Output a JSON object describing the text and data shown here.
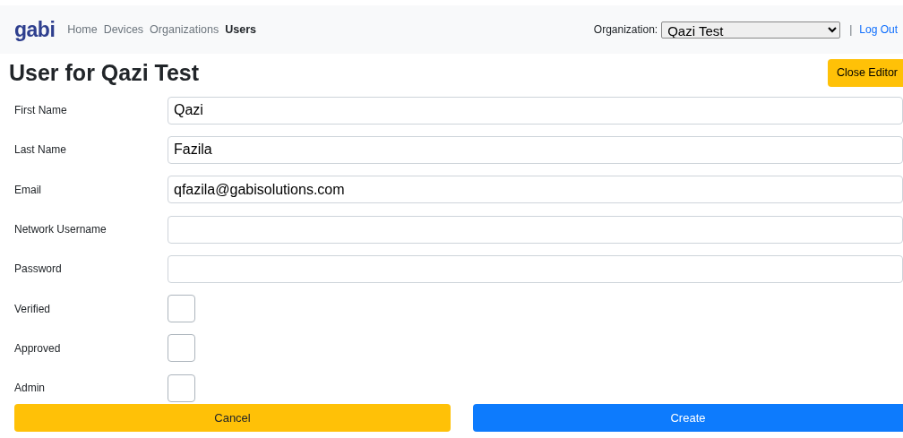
{
  "navbar": {
    "brand": "gabi",
    "links": [
      {
        "label": "Home",
        "selected": false
      },
      {
        "label": "Devices",
        "selected": false
      },
      {
        "label": "Organizations",
        "selected": false
      },
      {
        "label": "Users",
        "selected": true
      }
    ],
    "organization_label": "Organization:",
    "organization_value": "Qazi Test",
    "separator": "|",
    "logout": "Log Out"
  },
  "title": "User for Qazi Test",
  "close_button": "Close Editor",
  "fields": [
    {
      "kind": "text",
      "label": "First Name",
      "value": "Qazi"
    },
    {
      "kind": "text",
      "label": "Last Name",
      "value": "Fazila"
    },
    {
      "kind": "text",
      "label": "Email",
      "value": "qfazila@gabisolutions.com"
    },
    {
      "kind": "text",
      "label": "Network Username"
    },
    {
      "kind": "password",
      "label": "Password"
    },
    {
      "kind": "checkbox",
      "label": "Verified",
      "checked": false
    },
    {
      "kind": "checkbox",
      "label": "Approved",
      "checked": false
    },
    {
      "kind": "checkbox",
      "label": "Admin",
      "checked": false
    }
  ],
  "buttons": [
    {
      "kind": "cancel",
      "label": "Cancel"
    },
    {
      "kind": "create",
      "label": "Create"
    }
  ]
}
